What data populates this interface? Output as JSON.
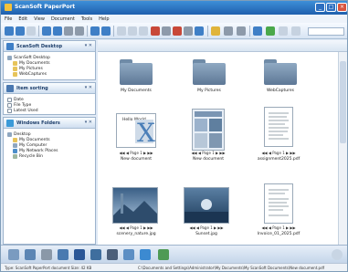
{
  "window": {
    "title": "ScanSoft PaperPort"
  },
  "menu": [
    "File",
    "Edit",
    "View",
    "Document",
    "Tools",
    "Help"
  ],
  "sidebar": {
    "desktop_panel": {
      "title": "ScanSoft Desktop",
      "items": [
        "ScanSoft Desktop",
        "My Documents",
        "My Pictures",
        "WebCaptures"
      ]
    },
    "search_panel": {
      "title": "Item sorting",
      "items": [
        "Date",
        "File Type",
        "Latest Used"
      ]
    },
    "windows_panel": {
      "title": "Windows Folders",
      "items": [
        "Desktop",
        "My Documents",
        "My Computer",
        "My Network Places",
        "Recycle Bin"
      ]
    }
  },
  "main": {
    "folders": [
      {
        "label": "My Documents"
      },
      {
        "label": "My Pictures"
      },
      {
        "label": "WebCaptures"
      }
    ],
    "documents": [
      {
        "label": "New document",
        "pager": "Page 1",
        "preview_text": "Hello World"
      },
      {
        "label": "New document",
        "pager": "Page 1"
      },
      {
        "label": "assignment2025.pdf",
        "pager": "Page 1"
      },
      {
        "label": "scenery_nature.jpg",
        "pager": "Page 1"
      },
      {
        "label": "Sunset.jpg",
        "pager": "Page 1"
      },
      {
        "label": "Invoice_01_2025.pdf",
        "pager": "Page 1"
      }
    ]
  },
  "statusbar": {
    "left": "Type: ScanSoft PaperPort document  Size: 42 KB",
    "right": "C:\\Documents and Settings\\Administrator\\My Documents\\My ScanSoft Documents\\New document.pdf"
  },
  "colors": {
    "titlebar": "#1f5fad",
    "accent": "#3f7fc6"
  }
}
